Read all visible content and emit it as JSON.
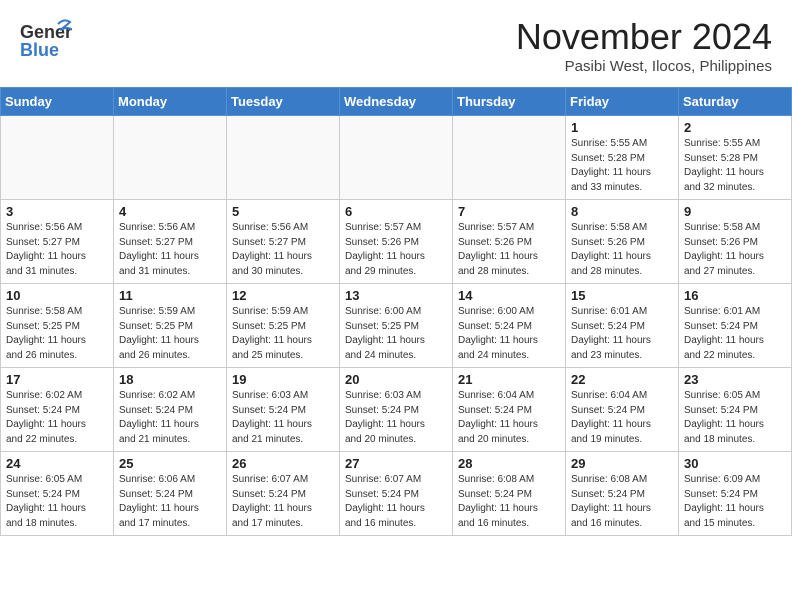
{
  "header": {
    "logo_text_general": "General",
    "logo_text_blue": "Blue",
    "month": "November 2024",
    "location": "Pasibi West, Ilocos, Philippines"
  },
  "weekdays": [
    "Sunday",
    "Monday",
    "Tuesday",
    "Wednesday",
    "Thursday",
    "Friday",
    "Saturday"
  ],
  "weeks": [
    [
      {
        "day": "",
        "info": ""
      },
      {
        "day": "",
        "info": ""
      },
      {
        "day": "",
        "info": ""
      },
      {
        "day": "",
        "info": ""
      },
      {
        "day": "",
        "info": ""
      },
      {
        "day": "1",
        "info": "Sunrise: 5:55 AM\nSunset: 5:28 PM\nDaylight: 11 hours\nand 33 minutes."
      },
      {
        "day": "2",
        "info": "Sunrise: 5:55 AM\nSunset: 5:28 PM\nDaylight: 11 hours\nand 32 minutes."
      }
    ],
    [
      {
        "day": "3",
        "info": "Sunrise: 5:56 AM\nSunset: 5:27 PM\nDaylight: 11 hours\nand 31 minutes."
      },
      {
        "day": "4",
        "info": "Sunrise: 5:56 AM\nSunset: 5:27 PM\nDaylight: 11 hours\nand 31 minutes."
      },
      {
        "day": "5",
        "info": "Sunrise: 5:56 AM\nSunset: 5:27 PM\nDaylight: 11 hours\nand 30 minutes."
      },
      {
        "day": "6",
        "info": "Sunrise: 5:57 AM\nSunset: 5:26 PM\nDaylight: 11 hours\nand 29 minutes."
      },
      {
        "day": "7",
        "info": "Sunrise: 5:57 AM\nSunset: 5:26 PM\nDaylight: 11 hours\nand 28 minutes."
      },
      {
        "day": "8",
        "info": "Sunrise: 5:58 AM\nSunset: 5:26 PM\nDaylight: 11 hours\nand 28 minutes."
      },
      {
        "day": "9",
        "info": "Sunrise: 5:58 AM\nSunset: 5:26 PM\nDaylight: 11 hours\nand 27 minutes."
      }
    ],
    [
      {
        "day": "10",
        "info": "Sunrise: 5:58 AM\nSunset: 5:25 PM\nDaylight: 11 hours\nand 26 minutes."
      },
      {
        "day": "11",
        "info": "Sunrise: 5:59 AM\nSunset: 5:25 PM\nDaylight: 11 hours\nand 26 minutes."
      },
      {
        "day": "12",
        "info": "Sunrise: 5:59 AM\nSunset: 5:25 PM\nDaylight: 11 hours\nand 25 minutes."
      },
      {
        "day": "13",
        "info": "Sunrise: 6:00 AM\nSunset: 5:25 PM\nDaylight: 11 hours\nand 24 minutes."
      },
      {
        "day": "14",
        "info": "Sunrise: 6:00 AM\nSunset: 5:24 PM\nDaylight: 11 hours\nand 24 minutes."
      },
      {
        "day": "15",
        "info": "Sunrise: 6:01 AM\nSunset: 5:24 PM\nDaylight: 11 hours\nand 23 minutes."
      },
      {
        "day": "16",
        "info": "Sunrise: 6:01 AM\nSunset: 5:24 PM\nDaylight: 11 hours\nand 22 minutes."
      }
    ],
    [
      {
        "day": "17",
        "info": "Sunrise: 6:02 AM\nSunset: 5:24 PM\nDaylight: 11 hours\nand 22 minutes."
      },
      {
        "day": "18",
        "info": "Sunrise: 6:02 AM\nSunset: 5:24 PM\nDaylight: 11 hours\nand 21 minutes."
      },
      {
        "day": "19",
        "info": "Sunrise: 6:03 AM\nSunset: 5:24 PM\nDaylight: 11 hours\nand 21 minutes."
      },
      {
        "day": "20",
        "info": "Sunrise: 6:03 AM\nSunset: 5:24 PM\nDaylight: 11 hours\nand 20 minutes."
      },
      {
        "day": "21",
        "info": "Sunrise: 6:04 AM\nSunset: 5:24 PM\nDaylight: 11 hours\nand 20 minutes."
      },
      {
        "day": "22",
        "info": "Sunrise: 6:04 AM\nSunset: 5:24 PM\nDaylight: 11 hours\nand 19 minutes."
      },
      {
        "day": "23",
        "info": "Sunrise: 6:05 AM\nSunset: 5:24 PM\nDaylight: 11 hours\nand 18 minutes."
      }
    ],
    [
      {
        "day": "24",
        "info": "Sunrise: 6:05 AM\nSunset: 5:24 PM\nDaylight: 11 hours\nand 18 minutes."
      },
      {
        "day": "25",
        "info": "Sunrise: 6:06 AM\nSunset: 5:24 PM\nDaylight: 11 hours\nand 17 minutes."
      },
      {
        "day": "26",
        "info": "Sunrise: 6:07 AM\nSunset: 5:24 PM\nDaylight: 11 hours\nand 17 minutes."
      },
      {
        "day": "27",
        "info": "Sunrise: 6:07 AM\nSunset: 5:24 PM\nDaylight: 11 hours\nand 16 minutes."
      },
      {
        "day": "28",
        "info": "Sunrise: 6:08 AM\nSunset: 5:24 PM\nDaylight: 11 hours\nand 16 minutes."
      },
      {
        "day": "29",
        "info": "Sunrise: 6:08 AM\nSunset: 5:24 PM\nDaylight: 11 hours\nand 16 minutes."
      },
      {
        "day": "30",
        "info": "Sunrise: 6:09 AM\nSunset: 5:24 PM\nDaylight: 11 hours\nand 15 minutes."
      }
    ]
  ]
}
